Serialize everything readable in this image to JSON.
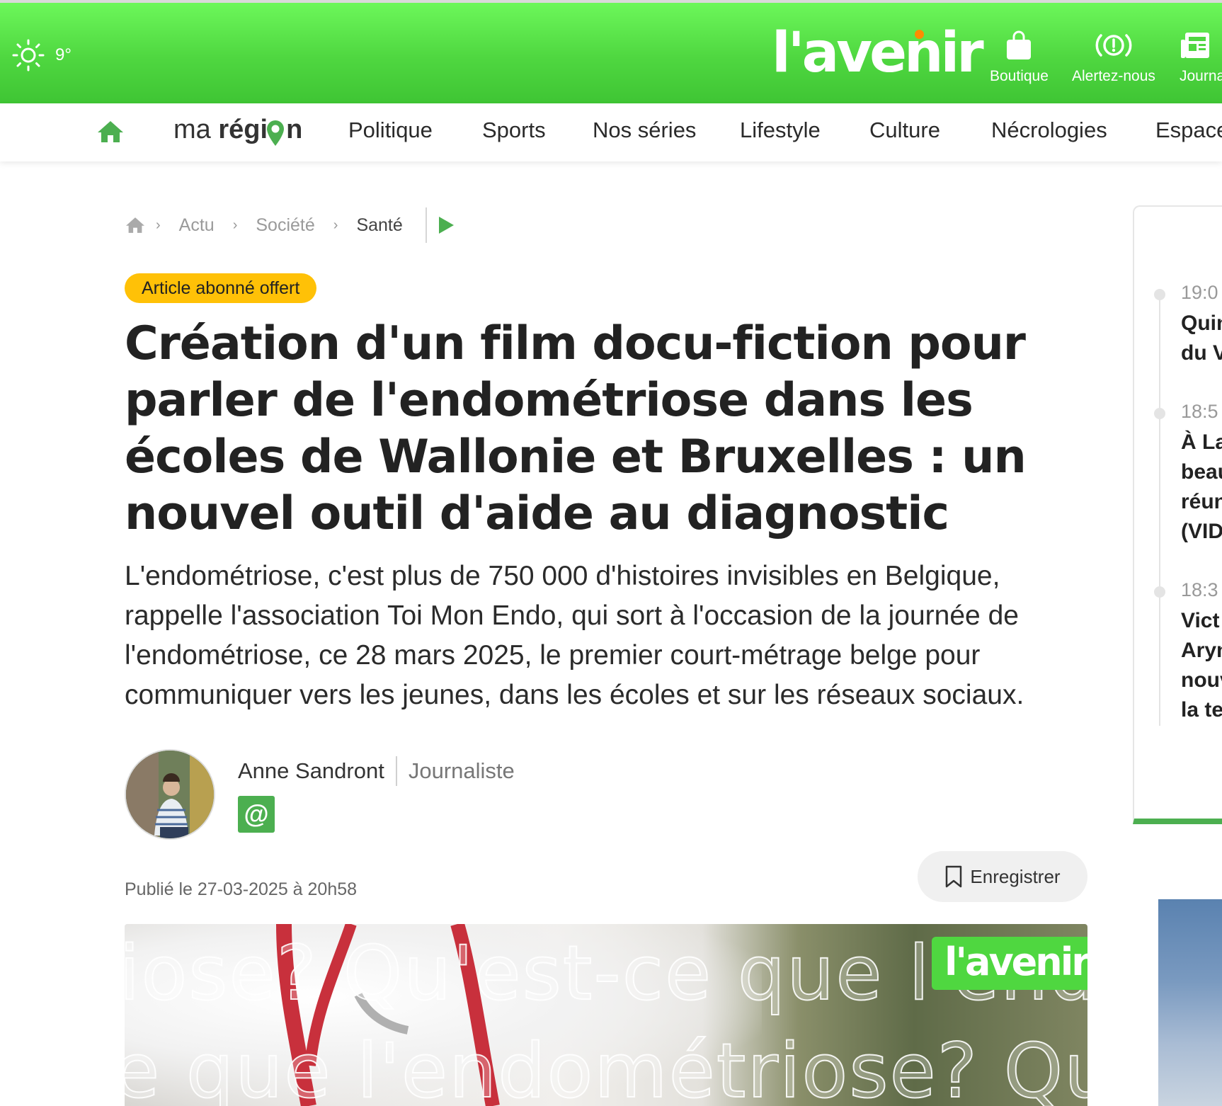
{
  "header": {
    "weather": {
      "icon": "sun-icon",
      "temp": "9°"
    },
    "logo": "l'avenir",
    "buttons": [
      {
        "label": "Boutique",
        "icon": "shopping-bag-icon"
      },
      {
        "label": "Alertez-nous",
        "icon": "alert-icon"
      },
      {
        "label": "Journa",
        "icon": "newspaper-icon"
      }
    ],
    "colors": {
      "brand_green": "#4fd740",
      "accent_orange": "#ff8c00"
    }
  },
  "nav": {
    "home_icon": "home-icon",
    "maregion_light": "ma",
    "maregion_bold": "régi",
    "maregion_bold_end": "n",
    "items": [
      "Politique",
      "Sports",
      "Nos séries",
      "Lifestyle",
      "Culture",
      "Nécrologies",
      "Espace"
    ]
  },
  "breadcrumb": {
    "items": [
      "Actu",
      "Société",
      "Santé"
    ],
    "play_icon": "play-icon"
  },
  "article": {
    "badge": "Article abonné offert",
    "title": "Création d'un film docu-fiction pour parler de l'endométriose dans les écoles de Wallonie et Bruxelles : un nouvel outil d'aide au diagnostic",
    "lead": "L'endométriose, c'est plus de 750 000 d'histoires invisibles en Belgique, rappelle l'association Toi Mon Endo, qui sort à l'occasion de la journée de l'endométriose, ce 28 mars 2025, le premier court-métrage belge pour communiquer vers les jeunes, dans les écoles et sur les réseaux sociaux.",
    "author_name": "Anne Sandront",
    "author_role": "Journaliste",
    "mail_symbol": "@",
    "published": "Publié le 27-03-2025 à 20h58",
    "save_label": "Enregistrer",
    "media_overlay_1": "iose? Qu'est-ce que l'endométr",
    "media_overlay_2": "e que l'endométriose? Qu'est-",
    "media_logo": "l'avenir"
  },
  "rail": {
    "items": [
      {
        "time": "19:0",
        "headline": "Quin\ndu V"
      },
      {
        "time": "18:5",
        "headline": "À La\nbeau\nréun\n(VID"
      },
      {
        "time": "18:3",
        "headline": "Vict\nAryn\nnouv\nla te"
      }
    ]
  }
}
